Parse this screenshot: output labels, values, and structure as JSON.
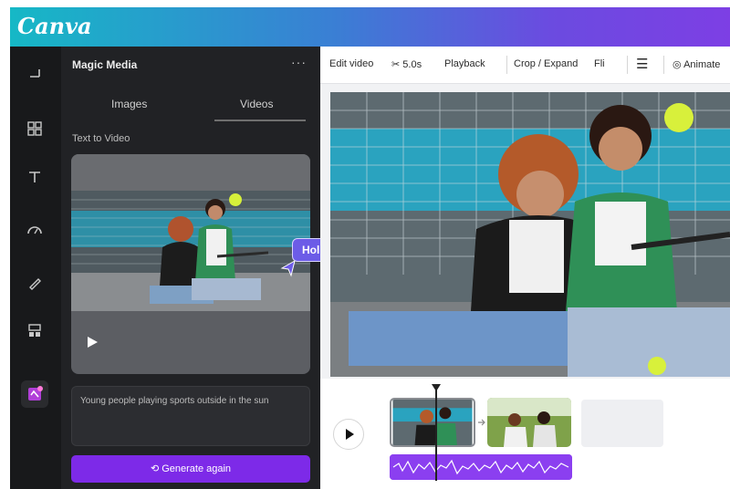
{
  "app": {
    "logo": "Canva"
  },
  "rail": {
    "items": [
      "upload-icon",
      "grid-icon",
      "text-icon",
      "gauge-icon",
      "draw-icon",
      "projects-icon",
      "magic-media-icon"
    ]
  },
  "panel": {
    "title": "Magic Media",
    "more": "···",
    "tabs": [
      "Images",
      "Videos"
    ],
    "active_tab": "Videos",
    "section_label": "Text to Video",
    "prompt": "Young people playing sports outside in the sun",
    "generate_label": "Generate again"
  },
  "badge": {
    "label": "Holly"
  },
  "toolbar": {
    "edit_video": "Edit video",
    "duration": "5.0s",
    "playback": "Playback",
    "crop": "Crop / Expand",
    "flip": "Fli",
    "animate": "Animate"
  },
  "colors": {
    "brand_purple": "#7d2ae8",
    "badge": "#6c5ce7",
    "dark_panel": "#212225"
  }
}
